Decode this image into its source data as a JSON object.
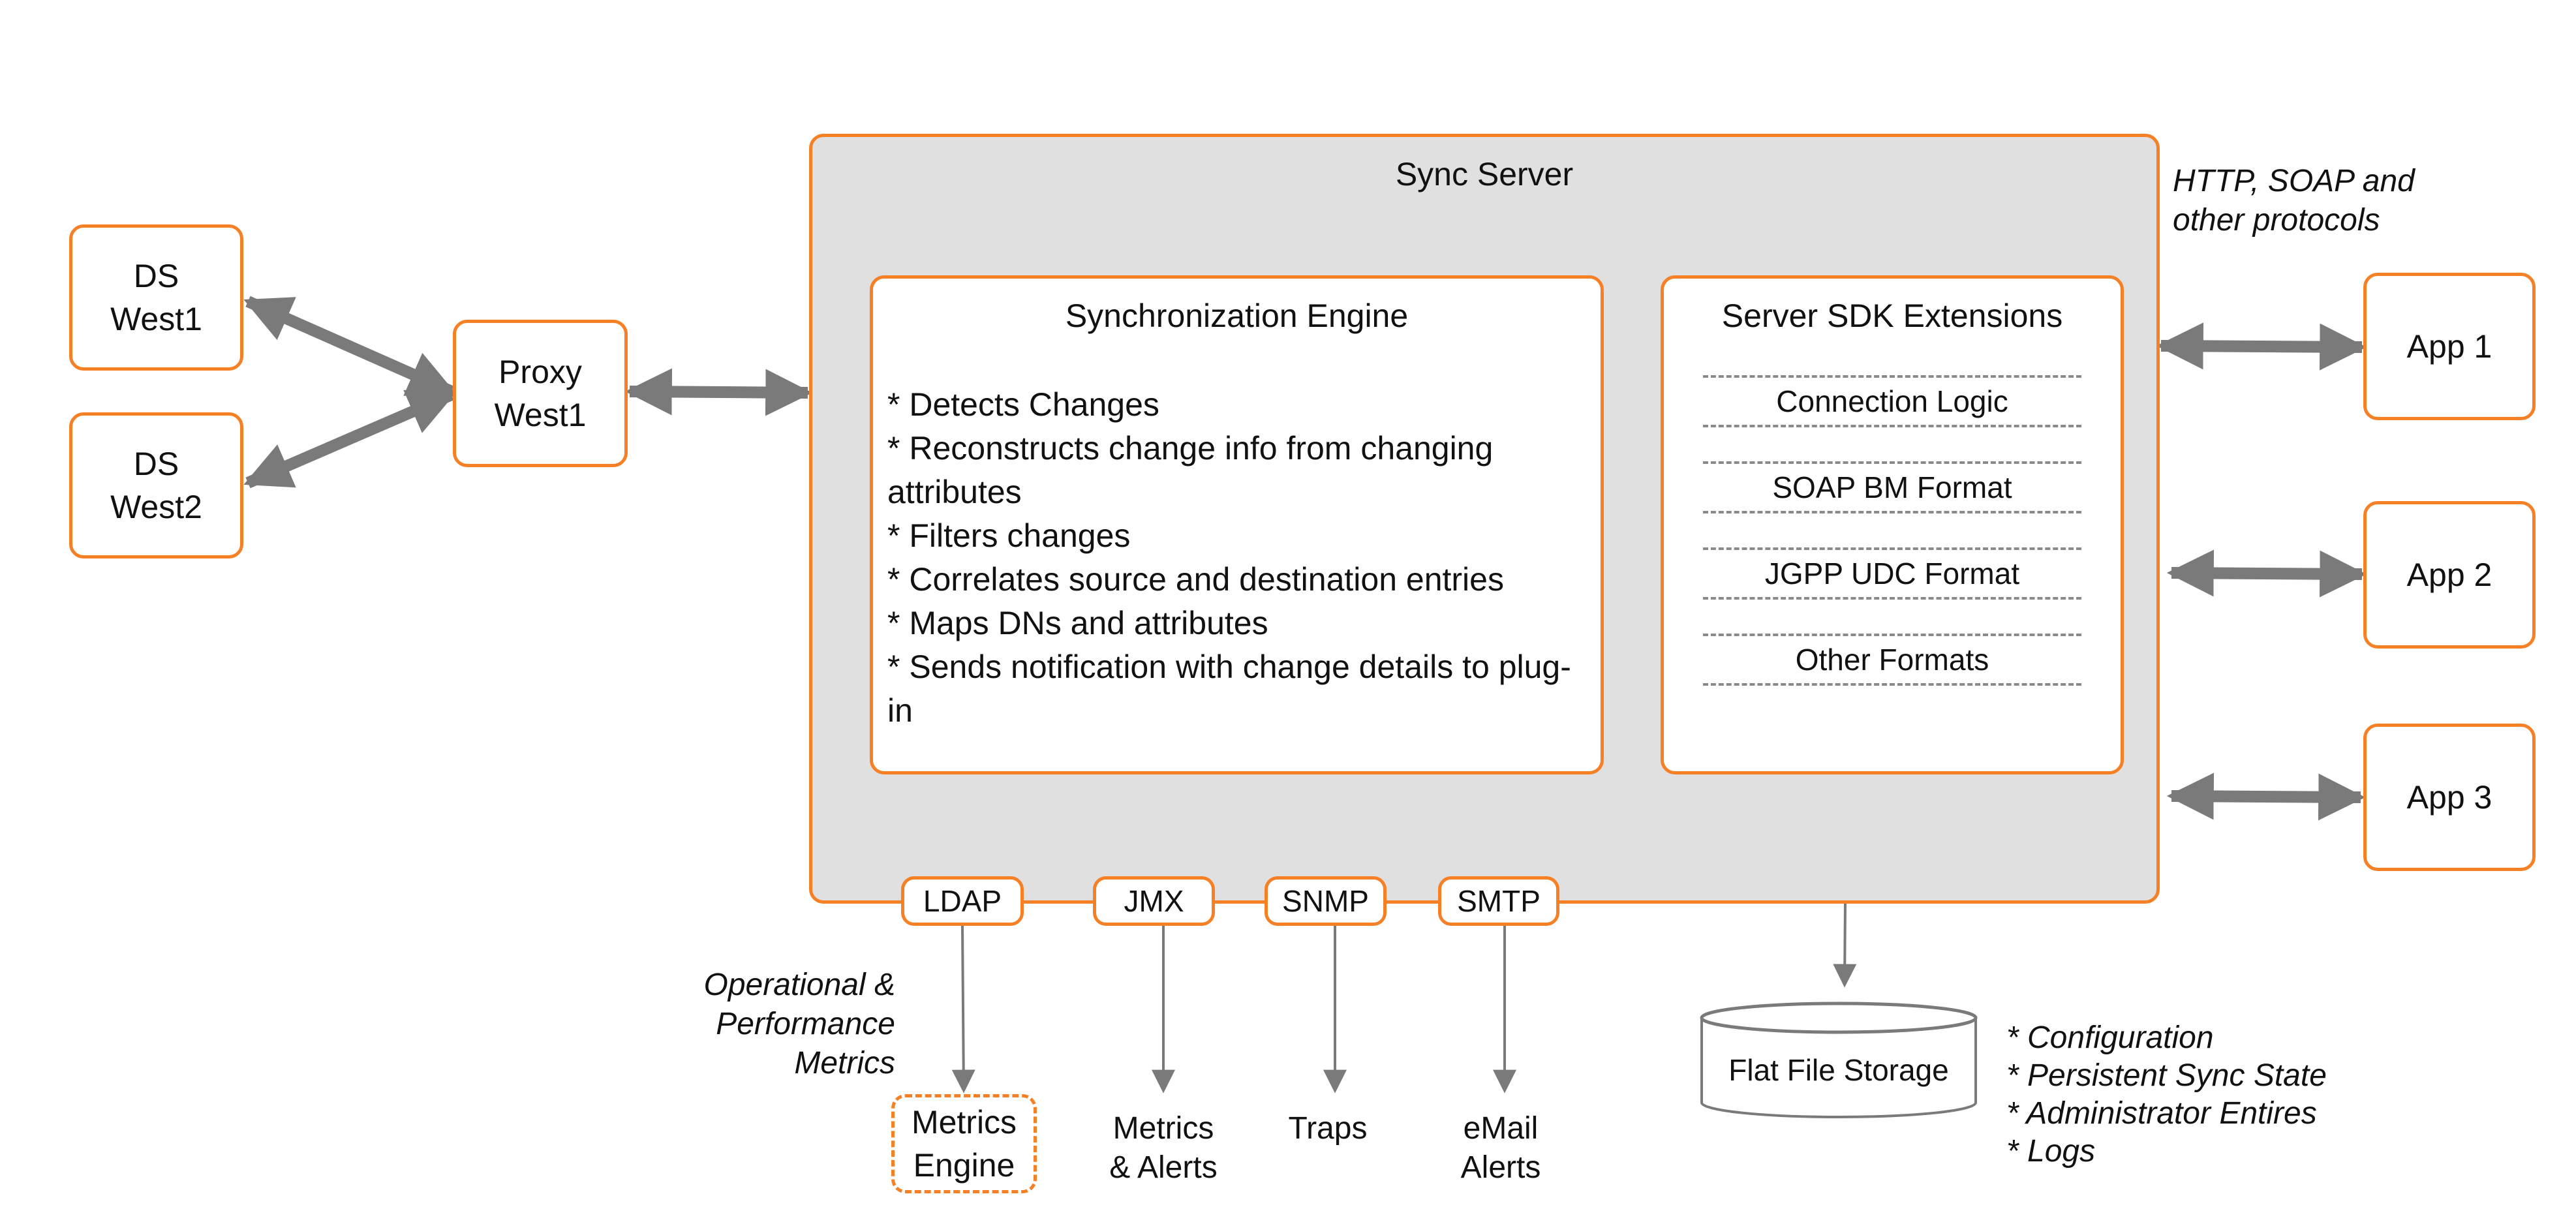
{
  "colors": {
    "accent": "#f58025",
    "arrow": "#7a7a7a",
    "server_fill": "#e0e0e0",
    "divider": "#8a8a8a"
  },
  "nodes": {
    "ds_west1": [
      "DS",
      "West1"
    ],
    "ds_west2": [
      "DS",
      "West2"
    ],
    "proxy_west1": [
      "Proxy",
      "West1"
    ],
    "app1": "App 1",
    "app2": "App 2",
    "app3": "App 3"
  },
  "sync_server": {
    "title": "Sync Server",
    "engine": {
      "title": "Synchronization Engine",
      "items": [
        "* Detects Changes",
        "* Reconstructs change info from changing attributes",
        "* Filters changes",
        "* Correlates source and destination entries",
        "* Maps DNs and attributes",
        "* Sends notification with change details to plug-in"
      ]
    },
    "sdk": {
      "title": "Server SDK Extensions",
      "items": [
        "Connection Logic",
        "SOAP BM Format",
        "JGPP UDC Format",
        "Other Formats"
      ]
    },
    "protocols": [
      "LDAP",
      "JMX",
      "SNMP",
      "SMTP"
    ]
  },
  "annotations": {
    "protocols_note": [
      "HTTP, SOAP and",
      "other protocols"
    ],
    "metrics_note": [
      "Operational &",
      "Performance",
      "Metrics"
    ],
    "storage_notes": [
      "* Configuration",
      "* Persistent Sync State",
      "* Administrator Entires",
      "* Logs"
    ]
  },
  "outputs": {
    "metrics_engine": [
      "Metrics",
      "Engine"
    ],
    "metrics_alerts": [
      "Metrics",
      "& Alerts"
    ],
    "traps": "Traps",
    "email_alerts": [
      "eMail",
      "Alerts"
    ]
  },
  "storage": {
    "label": "Flat File Storage"
  }
}
